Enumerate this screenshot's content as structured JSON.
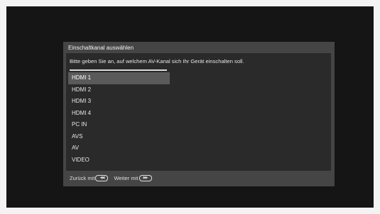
{
  "dialog": {
    "title": "Einschaltkanal auswählen",
    "instruction": "Bitte geben Sie an, auf welchem AV-Kanal sich Ihr Gerät einschalten soll.",
    "channels": [
      "HDMI 1",
      "HDMI 2",
      "HDMI 3",
      "HDMI 4",
      "PC IN",
      "AVS",
      "AV",
      "VIDEO"
    ],
    "selected": "HDMI 1"
  },
  "footer": {
    "back_label": "Zurück mit",
    "next_label": "Weiter mit",
    "back_icon": "rewind-icon",
    "next_icon": "fast-forward-icon"
  },
  "colors": {
    "screen": "#151515",
    "dialog_frame": "#454545",
    "dialog_body": "#2a2a2a",
    "selection": "#5a5a5a"
  }
}
